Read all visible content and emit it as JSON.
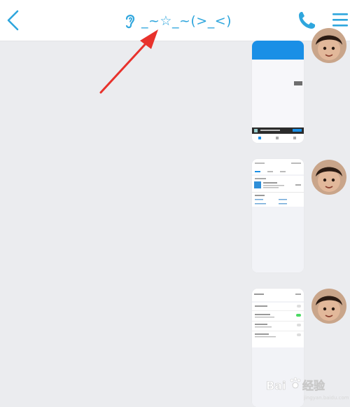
{
  "header": {
    "title": "_~☆_~(>_<)",
    "icons": {
      "back": "chevron-left-icon",
      "ear": "ear-icon",
      "call": "phone-icon",
      "menu": "hamburger-menu-icon"
    },
    "accent_color": "#2fa6dd"
  },
  "messages": [
    {
      "type": "image",
      "description_icon": "screenshot-thumbnail",
      "dominant_color": "#1a8fe6"
    },
    {
      "type": "image",
      "description_icon": "screenshot-thumbnail",
      "dominant_color": "#f2f3f7"
    },
    {
      "type": "image",
      "description_icon": "screenshot-thumbnail",
      "dominant_color": "#f2f3f7"
    }
  ],
  "watermark": {
    "logo_text": "Bai",
    "cn_text": "经验",
    "sub_text": "jingyan.baidu.com"
  },
  "annotation": {
    "type": "red-arrow",
    "color": "#e8322c"
  }
}
